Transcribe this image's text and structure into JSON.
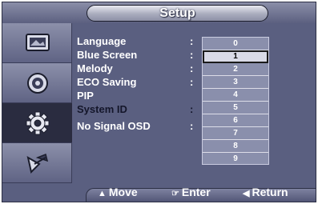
{
  "header": {
    "title": "Setup"
  },
  "sidebar": {
    "tabs": [
      {
        "icon": "picture-icon",
        "selected": false
      },
      {
        "icon": "sound-icon",
        "selected": false
      },
      {
        "icon": "gear-icon",
        "selected": true
      },
      {
        "icon": "satellite-icon",
        "selected": false
      }
    ]
  },
  "menu": {
    "items": [
      {
        "label": "Language",
        "active": false
      },
      {
        "label": "Blue Screen",
        "active": false
      },
      {
        "label": "Melody",
        "active": false
      },
      {
        "label": "ECO Saving",
        "active": false
      },
      {
        "label": "PIP",
        "active": false
      },
      {
        "label": "System ID",
        "active": true
      },
      {
        "label": "No Signal OSD",
        "active": false
      }
    ],
    "separator": ":"
  },
  "dropdown": {
    "options": [
      "0",
      "1",
      "2",
      "3",
      "4",
      "5",
      "6",
      "7",
      "8",
      "9"
    ],
    "selected_value": "1"
  },
  "footer": {
    "move_label": "Move",
    "enter_label": "Enter",
    "return_label": "Return"
  },
  "colors": {
    "background": "#5a5f80",
    "header_pill": "#a9acbe",
    "selected_tab": "#2a2c40",
    "dropdown": "#8a8fac",
    "dropdown_selected": "#d9dae6"
  }
}
